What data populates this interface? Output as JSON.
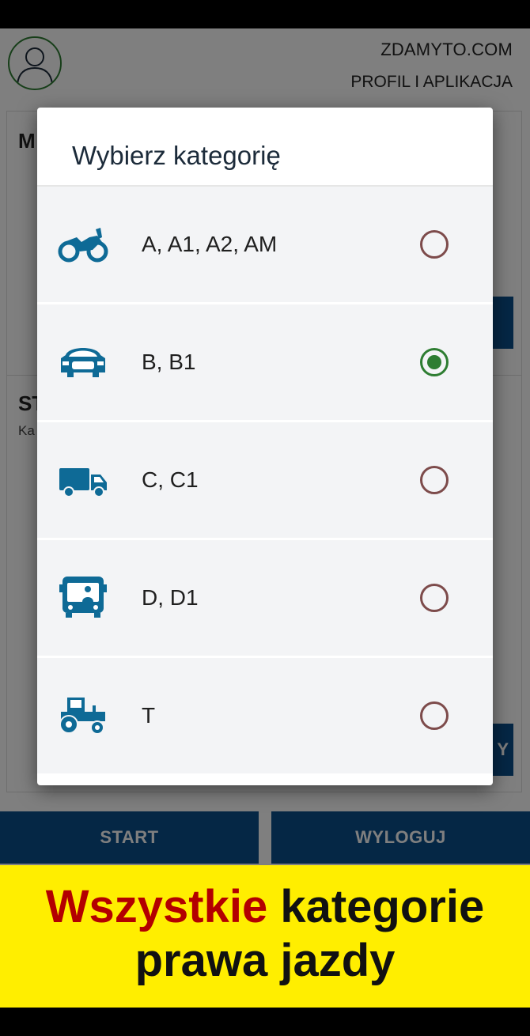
{
  "header": {
    "site": "ZDAMYTO.COM",
    "profile_link": "PROFIL I APLIKACJA"
  },
  "cards": {
    "card1_title_partial": "M",
    "card2_title_partial": "ST",
    "card2_sub_partial": "Ka",
    "card2_btn_partial": "Y"
  },
  "buttons": {
    "start": "START",
    "logout": "WYLOGUJ"
  },
  "dialog": {
    "title": "Wybierz kategorię",
    "selected": "B, B1",
    "options": [
      {
        "label": "A, A1, A2, AM",
        "icon": "motorcycle-icon",
        "checked": false
      },
      {
        "label": "B, B1",
        "icon": "car-icon",
        "checked": true
      },
      {
        "label": "C, C1",
        "icon": "truck-icon",
        "checked": false
      },
      {
        "label": "D, D1",
        "icon": "bus-icon",
        "checked": false
      },
      {
        "label": "T",
        "icon": "tractor-icon",
        "checked": false
      }
    ]
  },
  "banner": {
    "highlight": "Wszystkie",
    "rest_line1": "kategorie",
    "line2": "prawa jazdy"
  },
  "colors": {
    "icon": "#0e6a96",
    "radio_checked": "#2e7d32",
    "radio_unchecked": "#7d4b4b",
    "primary_button": "#0b4f8a",
    "banner_bg": "#ffee00",
    "banner_highlight": "#b30000"
  }
}
